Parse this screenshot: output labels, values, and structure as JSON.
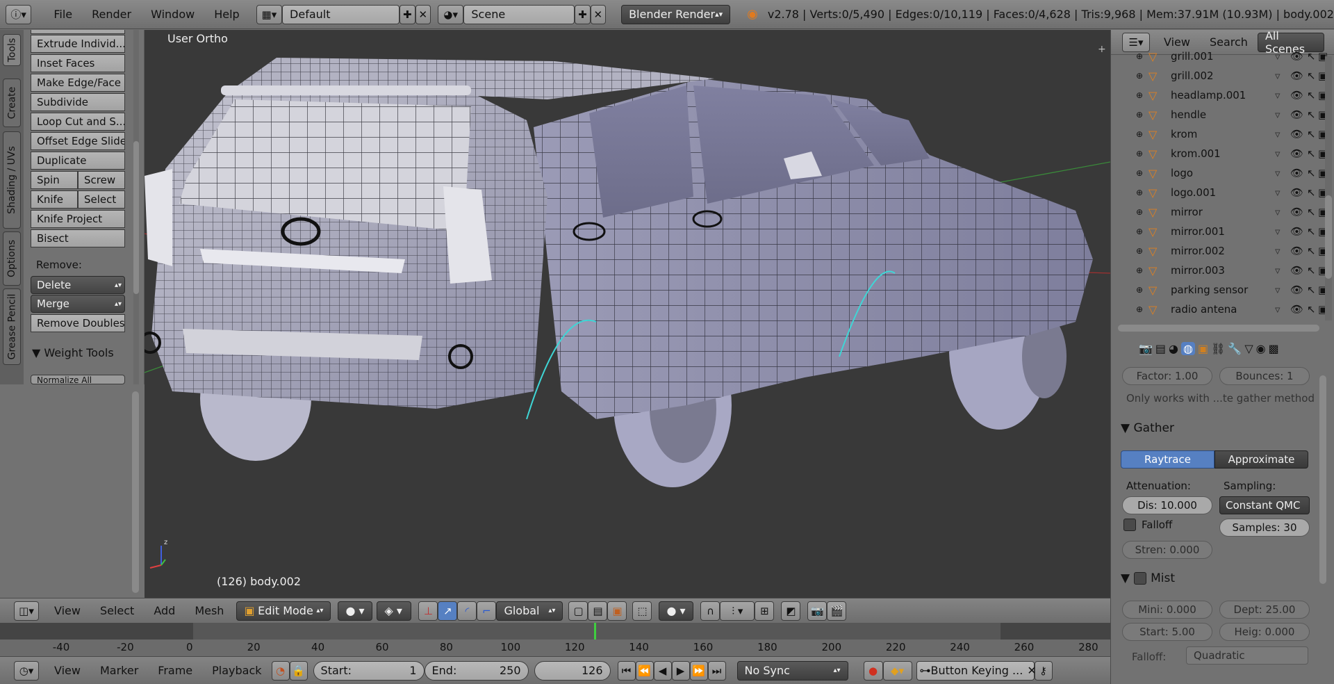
{
  "topbar": {
    "menus": [
      "File",
      "Render",
      "Window",
      "Help"
    ],
    "screen_layout": "Default",
    "scene": "Scene",
    "render_engine": "Blender Render",
    "stats": "v2.78 | Verts:0/5,490 | Edges:0/10,119 | Faces:0/4,628 | Tris:9,968 | Mem:37.91M (10.93M) | body.002"
  },
  "left_tabs": [
    "Tools",
    "Create",
    "Shading / UVs",
    "Options",
    "Grease Pencil"
  ],
  "tools": {
    "buttons": [
      "Extrude Individ...",
      "Inset Faces",
      "Make Edge/Face",
      "Subdivide",
      "Loop Cut and S...",
      "Offset Edge Slide",
      "Duplicate"
    ],
    "pairs": [
      [
        "Spin",
        "Screw"
      ],
      [
        "Knife",
        "Select"
      ]
    ],
    "buttons2": [
      "Knife Project",
      "Bisect"
    ],
    "remove_label": "Remove:",
    "delete_label": "Delete",
    "merge_label": "Merge",
    "remove_doubles": "Remove Doubles",
    "weight_tools": "Weight Tools",
    "normalize": "Normalize All"
  },
  "viewport": {
    "view_label": "User Ortho",
    "object_label": "(126) body.002"
  },
  "v3d_header": {
    "menus": [
      "View",
      "Select",
      "Add",
      "Mesh"
    ],
    "mode": "Edit Mode",
    "orientation": "Global"
  },
  "timeline": {
    "ticks": [
      "-40",
      "-20",
      "0",
      "20",
      "40",
      "60",
      "80",
      "100",
      "120",
      "140",
      "160",
      "180",
      "200",
      "220",
      "240",
      "260",
      "280"
    ],
    "current_frame_fraction": 0.432
  },
  "bottombar": {
    "menus": [
      "View",
      "Marker",
      "Frame",
      "Playback"
    ],
    "start_label": "Start:",
    "start": "1",
    "end_label": "End:",
    "end": "250",
    "current": "126",
    "sync": "No Sync",
    "keying": "Button Keying ..."
  },
  "outliner": {
    "header": [
      "View",
      "Search",
      "All Scenes"
    ],
    "items": [
      "grill.001",
      "grill.002",
      "headlamp.001",
      "hendle",
      "krom",
      "krom.001",
      "logo",
      "logo.001",
      "mirror",
      "mirror.001",
      "mirror.002",
      "mirror.003",
      "parking sensor",
      "radio antena"
    ]
  },
  "properties": {
    "factor": "Factor: 1.00",
    "bounces": "Bounces:  1",
    "note": "Only works with ...te gather method",
    "gather": "Gather",
    "raytrace": "Raytrace",
    "approximate": "Approximate",
    "attenuation": "Attenuation:",
    "sampling": "Sampling:",
    "dis": "Dis: 10.000",
    "constant": "Constant QMC",
    "falloff": "Falloff",
    "samples": "Samples: 30",
    "stren": "Stren: 0.000",
    "mist": "Mist",
    "mini": "Mini:  0.000",
    "dept": "Dept: 25.00",
    "start": "Start:   5.00",
    "heig": "Heig: 0.000",
    "falloff2": "Falloff:",
    "quadratic": "Quadratic"
  },
  "colors": {
    "accent": "#5680c2",
    "viewport_bg": "#393939",
    "selected_edge": "#3fd6d6"
  }
}
